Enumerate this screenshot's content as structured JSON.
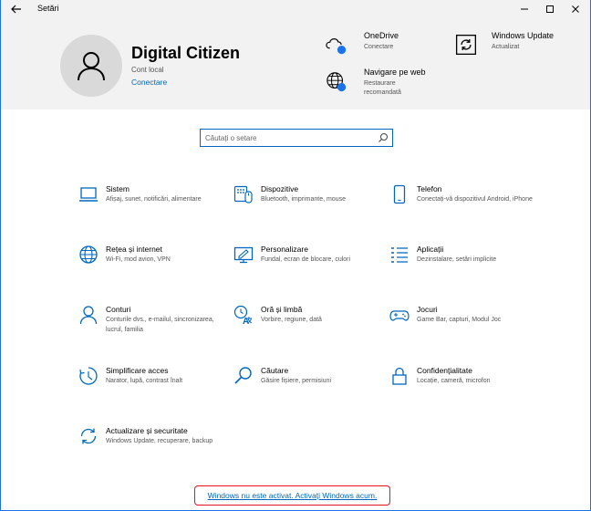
{
  "window": {
    "title": "Setări"
  },
  "account": {
    "name": "Digital Citizen",
    "type": "Cont local",
    "sign_in": "Conectare"
  },
  "header_items": [
    {
      "title": "OneDrive",
      "subtitle": "Conectare",
      "icon": "onedrive-icon"
    },
    {
      "title": "Windows Update",
      "subtitle": "Actualizat",
      "icon": "windows-update-icon"
    },
    {
      "title": "Navigare pe web",
      "subtitle": "Restaurare recomandată",
      "icon": "globe-icon"
    }
  ],
  "search": {
    "placeholder": "Căutați o setare"
  },
  "categories": [
    {
      "title": "Sistem",
      "desc": "Afișaj, sunet, notificări, alimentare",
      "icon": "laptop-icon"
    },
    {
      "title": "Dispozitive",
      "desc": "Bluetooth, imprimante, mouse",
      "icon": "devices-icon"
    },
    {
      "title": "Telefon",
      "desc": "Conectați-vă dispozitivul Android, iPhone",
      "icon": "phone-icon"
    },
    {
      "title": "Rețea și internet",
      "desc": "Wi-Fi, mod avion, VPN",
      "icon": "globe-icon"
    },
    {
      "title": "Personalizare",
      "desc": "Fundal, ecran de blocare, culori",
      "icon": "personalization-icon"
    },
    {
      "title": "Aplicații",
      "desc": "Dezinstalare, setări implicite",
      "icon": "apps-list-icon"
    },
    {
      "title": "Conturi",
      "desc": "Conturile dvs., e-mailul, sincronizarea, lucrul, familia",
      "icon": "person-icon"
    },
    {
      "title": "Oră și limbă",
      "desc": "Vorbire, regiune, dată",
      "icon": "time-language-icon"
    },
    {
      "title": "Jocuri",
      "desc": "Game Bar, capturi, Modul Joc",
      "icon": "gamepad-icon"
    },
    {
      "title": "Simplificare acces",
      "desc": "Narator, lupă, contrast înalt",
      "icon": "ease-of-access-icon"
    },
    {
      "title": "Căutare",
      "desc": "Găsire fișiere, permisiuni",
      "icon": "search-icon"
    },
    {
      "title": "Confidențialitate",
      "desc": "Locație, cameră, microfon",
      "icon": "lock-icon"
    },
    {
      "title": "Actualizare și securitate",
      "desc": "Windows Update, recuperare, backup",
      "icon": "update-sync-icon"
    }
  ],
  "activation": {
    "text": "Windows nu este activat. Activați Windows acum."
  },
  "colors": {
    "accent": "#0067c0",
    "header_bg": "#f2f2f2",
    "activation_border": "#e81123"
  }
}
